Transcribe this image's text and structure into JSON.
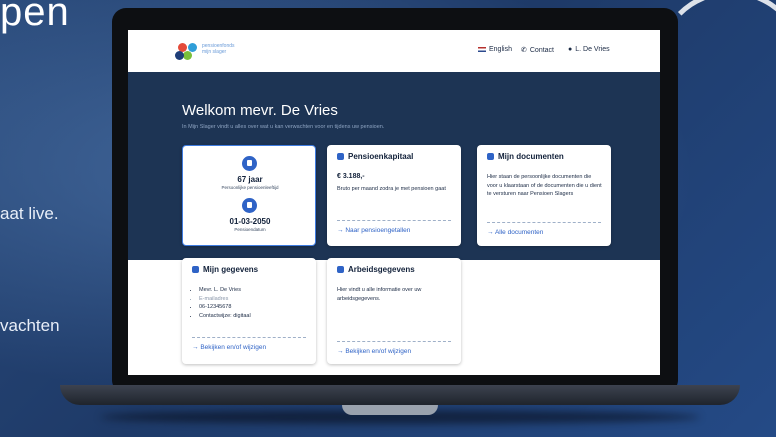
{
  "background": {
    "title_fragment": "pen",
    "line1": "aat live.",
    "line2": "vachten"
  },
  "header": {
    "logo_text_line1": "pensioenfonds",
    "logo_text_line2": "mijn slager",
    "lang": "English",
    "contact": "Contact",
    "user": "L. De Vries"
  },
  "hero": {
    "title": "Welkom mevr. De Vries",
    "subtitle": "In Mijn Slager vindt u alles over wat u kan verwachten voor en tijdens uw pensioen."
  },
  "age_card": {
    "age": "67 jaar",
    "age_label": "Persoonlijke pensioenleeftijd",
    "date": "01-03-2050",
    "date_label": "Pensioendatum"
  },
  "pensioen": {
    "title": "Pensioenkapitaal",
    "amount": "€ 3.188,-",
    "desc": "Bruto per maand zodra je met pensioen gaat",
    "link": "Naar pensioengetallen"
  },
  "documenten": {
    "title": "Mijn documenten",
    "desc": "Hier staan de persoonlijke documenten die voor u klaarstaan of de documenten die u dient te versturen naar Pensioen Slagers",
    "link": "Alle documenten"
  },
  "gegevens": {
    "title": "Mijn gegevens",
    "items": [
      "Mevr. L. De Vries",
      "E-mailadres",
      "06-12345678",
      "Contactwijze: digitaal"
    ],
    "link": "Bekijken en/of wijzigen"
  },
  "arbeid": {
    "title": "Arbeidsgegevens",
    "desc": "Hier vindt u alle informatie over uw arbeidsgegevens.",
    "link": "Bekijken en/of wijzigen"
  },
  "colors": {
    "navy": "#1d3454",
    "accent": "#2f63c6"
  }
}
